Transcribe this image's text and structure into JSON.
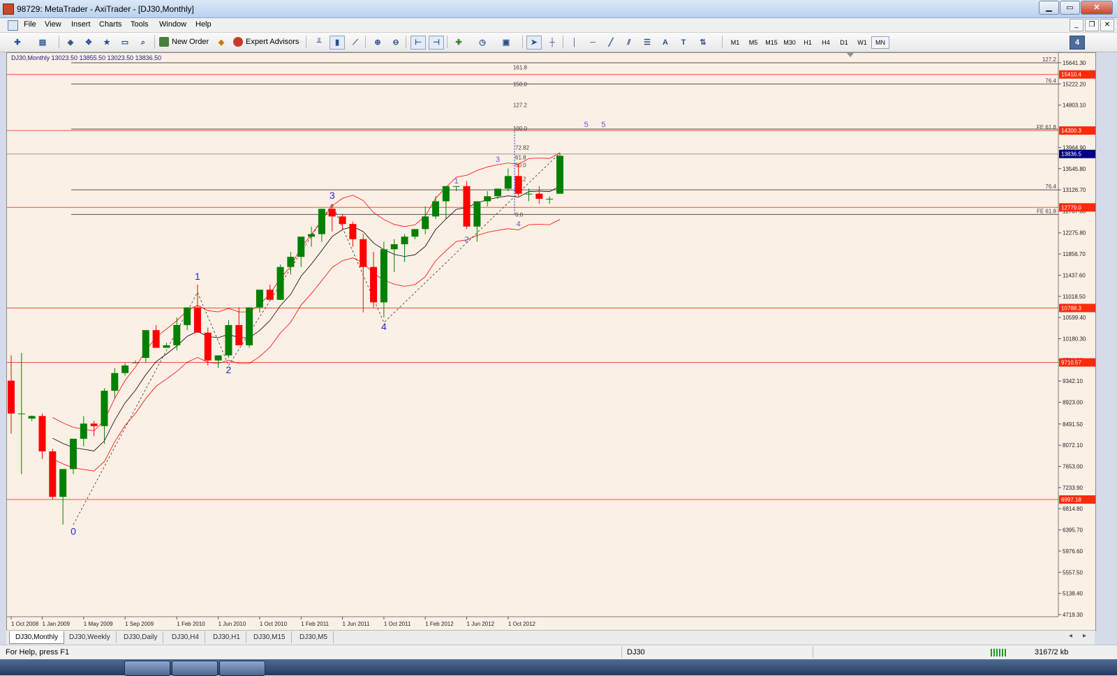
{
  "window": {
    "title": "98729: MetaTrader - AxiTrader - [DJ30,Monthly]"
  },
  "menu": [
    "File",
    "View",
    "Insert",
    "Charts",
    "Tools",
    "Window",
    "Help"
  ],
  "toolbar": {
    "new_order": "New Order",
    "expert_advisors": "Expert Advisors",
    "text_tool": "A",
    "timeframes": [
      "M1",
      "M5",
      "M15",
      "M30",
      "H1",
      "H4",
      "D1",
      "W1",
      "MN"
    ],
    "active_timeframe": "MN"
  },
  "chart": {
    "info": "DJ30,Monthly  13023.50 13855.50 13023.50 13836.50",
    "symbol": "DJ30",
    "timeframe": "Monthly"
  },
  "chart_data": {
    "type": "candlestick",
    "symbol": "DJ30",
    "period": "Monthly",
    "current_price": 13836.5,
    "ohlc": {
      "open": 13023.5,
      "high": 13855.5,
      "low": 13023.5,
      "close": 13836.5
    },
    "y_ticks": [
      "15641.30",
      "15222.20",
      "14803.10",
      "13964.90",
      "13545.80",
      "13126.70",
      "12707.60",
      "12275.80",
      "11856.70",
      "11437.60",
      "11018.50",
      "10599.40",
      "10180.30",
      "9761.20",
      "9342.10",
      "8923.00",
      "8491.50",
      "8072.10",
      "7653.00",
      "7233.90",
      "6814.80",
      "6395.70",
      "5976.60",
      "5557.50",
      "5138.40",
      "4719.30"
    ],
    "x_ticks": [
      "1 Oct 2008",
      "1 Jan 2009",
      "1 May 2009",
      "1 Sep 2009",
      "1 Feb 2010",
      "1 Jun 2010",
      "1 Oct 2010",
      "1 Feb 2011",
      "1 Jun 2011",
      "1 Oct 2011",
      "1 Feb 2012",
      "1 Jun 2012",
      "1 Oct 2012"
    ],
    "colors": {
      "bull": "#008000",
      "bear": "#ff0000",
      "background": "#fbf0e5",
      "horizontal_line": "#e8543a",
      "fib_line": "#505050",
      "ma": "#000000",
      "envelope": "#ff0000",
      "wave_label": "#2424d8"
    },
    "candles": [
      [
        9350,
        9850,
        8300,
        8700
      ],
      [
        8700,
        9900,
        7500,
        8700
      ],
      [
        8600,
        8660,
        8550,
        8650
      ],
      [
        8650,
        8700,
        7800,
        7950
      ],
      [
        7950,
        8000,
        7000,
        7050
      ],
      [
        7050,
        7300,
        6500,
        7600
      ],
      [
        7600,
        8200,
        7500,
        8200
      ],
      [
        8200,
        8650,
        8050,
        8500
      ],
      [
        8500,
        8550,
        8250,
        8450
      ],
      [
        8450,
        9200,
        8100,
        9150
      ],
      [
        9150,
        9600,
        9000,
        9500
      ],
      [
        9500,
        9700,
        9450,
        9650
      ],
      [
        9700,
        9750,
        9700,
        9710
      ],
      [
        9800,
        10150,
        9700,
        10350
      ],
      [
        10350,
        10450,
        10100,
        10000
      ],
      [
        10000,
        10100,
        10000,
        10050
      ],
      [
        10050,
        10600,
        9950,
        10450
      ],
      [
        10450,
        10800,
        10350,
        10800
      ],
      [
        10800,
        11250,
        10500,
        10300
      ],
      [
        10300,
        10400,
        9650,
        9750
      ],
      [
        9750,
        9800,
        9600,
        9850
      ],
      [
        9850,
        10550,
        9800,
        10450
      ],
      [
        10450,
        10800,
        10100,
        10050
      ],
      [
        10050,
        10400,
        10000,
        10800
      ],
      [
        10800,
        11150,
        10700,
        11150
      ],
      [
        11150,
        11250,
        10950,
        10950
      ],
      [
        10950,
        11650,
        10950,
        11600
      ],
      [
        11600,
        11900,
        11450,
        11800
      ],
      [
        11800,
        12100,
        11600,
        12200
      ],
      [
        12200,
        12400,
        12000,
        12250
      ],
      [
        12250,
        12700,
        12100,
        12750
      ],
      [
        12750,
        12850,
        12300,
        12600
      ],
      [
        12600,
        12650,
        12350,
        12450
      ],
      [
        12450,
        12500,
        12000,
        12150
      ],
      [
        12150,
        12250,
        10700,
        11600
      ],
      [
        11600,
        11900,
        10800,
        10900
      ],
      [
        10900,
        12100,
        10600,
        11950
      ],
      [
        11950,
        12150,
        11500,
        12050
      ],
      [
        12050,
        12250,
        11700,
        12200
      ],
      [
        12200,
        12300,
        12150,
        12350
      ],
      [
        12350,
        12800,
        12250,
        12600
      ],
      [
        12600,
        13000,
        12550,
        12900
      ],
      [
        12900,
        13050,
        12550,
        13200
      ],
      [
        13200,
        13200,
        13100,
        13200
      ],
      [
        13200,
        13300,
        12350,
        12400
      ],
      [
        12400,
        12850,
        12100,
        12900
      ],
      [
        12900,
        13100,
        12800,
        13000
      ],
      [
        13000,
        13150,
        12950,
        13150
      ],
      [
        13150,
        13550,
        13100,
        13400
      ],
      [
        13400,
        13650,
        13000,
        13050
      ],
      [
        13050,
        13150,
        12900,
        13050
      ],
      [
        13050,
        13200,
        12850,
        12950
      ],
      [
        12950,
        13000,
        12850,
        12950
      ],
      [
        13050,
        13850,
        13050,
        13800
      ]
    ],
    "horizontal_lines": [
      15410.4,
      14300.3,
      12779.0,
      10788.3,
      9710.57,
      6997.18
    ],
    "price_labels": [
      "15410.4",
      "14300.3",
      "13836.5",
      "12779.0",
      "10788.3",
      "9710.57",
      "6997.18"
    ],
    "fib_levels": {
      "right": [
        "127.2",
        "76.4",
        "FE 61.8",
        "76.4",
        "FE 61.8"
      ],
      "middle": [
        "161.8",
        "150.0",
        "127.2",
        "100.0",
        "72.82",
        "61.8",
        "50.0",
        "38.2",
        "0.0"
      ]
    },
    "wave_labels": [
      "0",
      "1",
      "2",
      "3",
      "4",
      "1",
      "2",
      "3",
      "4",
      "5",
      "5"
    ]
  },
  "tabs": [
    "DJ30,Monthly",
    "DJ30,Weekly",
    "DJ30,Daily",
    "DJ30,H4",
    "DJ30,H1",
    "DJ30,M15",
    "DJ30,M5"
  ],
  "status": {
    "help": "For Help, press F1",
    "symbol": "DJ30",
    "traffic": "3167/2 kb"
  }
}
